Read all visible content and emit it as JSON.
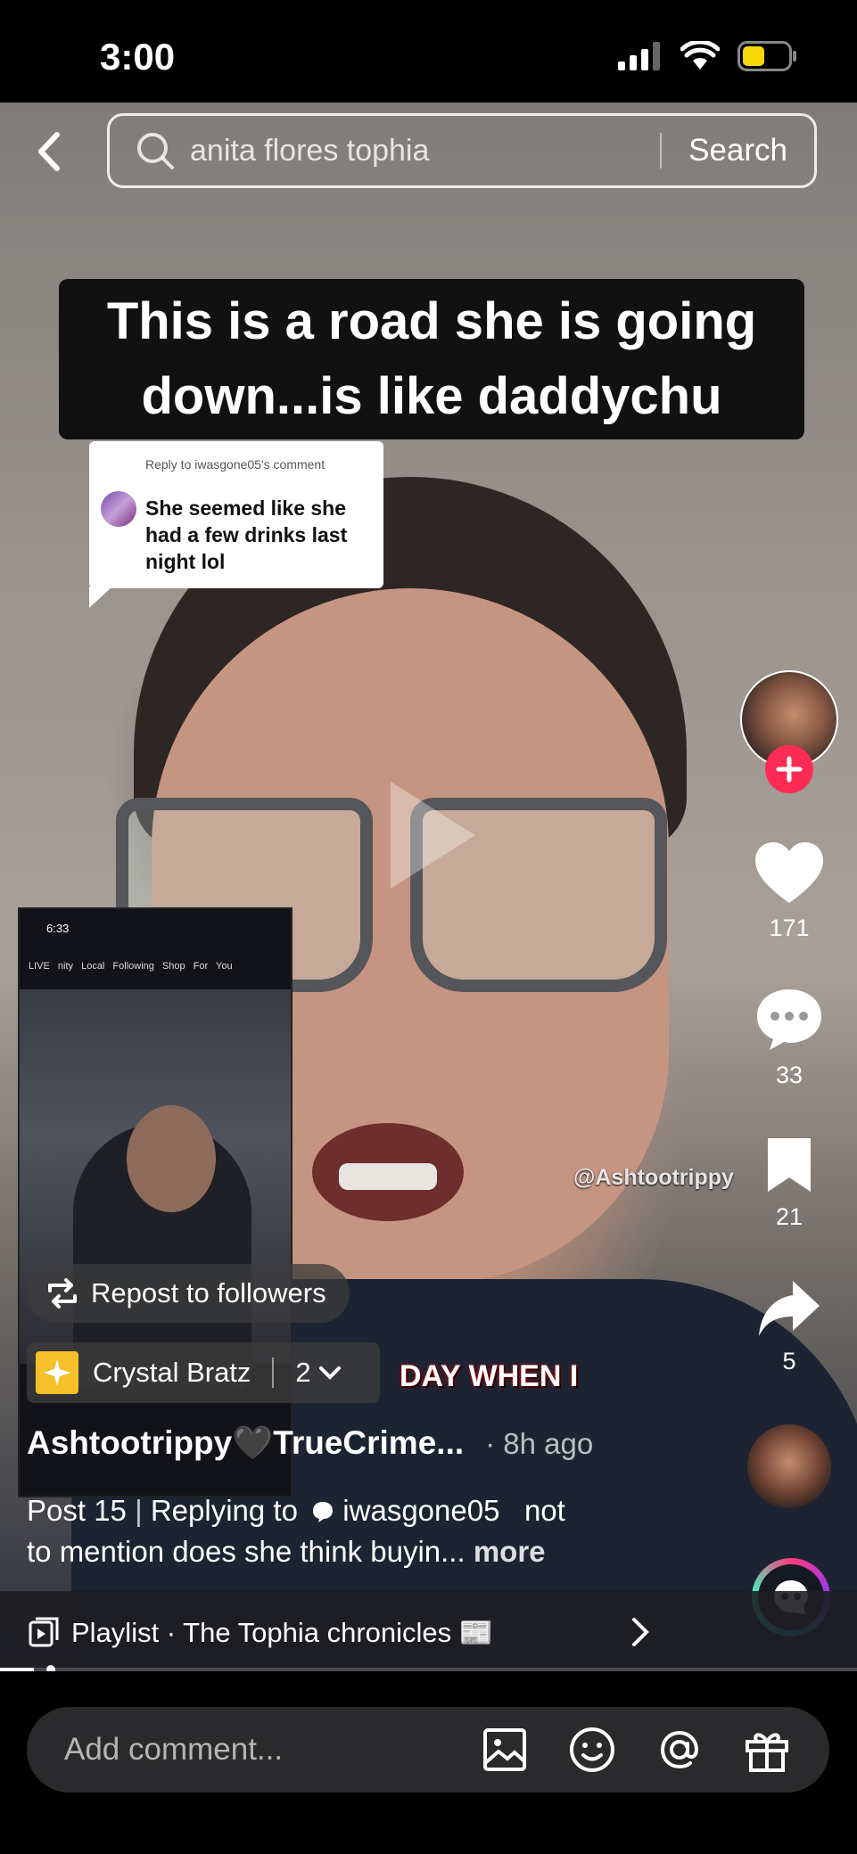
{
  "status_bar": {
    "time": "3:00"
  },
  "search": {
    "query": "anita flores tophia",
    "button_label": "Search"
  },
  "caption": {
    "line1": "This is a road she is going",
    "line2": "down...is like daddychu"
  },
  "reply": {
    "header": "Reply to iwasgone05's comment",
    "text": "She seemed like she had a few drinks last night lol"
  },
  "pip": {
    "status_time": "6:33",
    "tabs": "LIVE nity Local Following Shop For You"
  },
  "overlay": {
    "watermark": "@Ashtootrippy",
    "subtitle": "DAY WHEN I"
  },
  "actions": {
    "likes": "171",
    "comments": "33",
    "saves": "21",
    "shares": "5"
  },
  "repost": {
    "label": "Repost to followers"
  },
  "collab": {
    "name": "Crystal Bratz",
    "count": "2"
  },
  "post": {
    "author": "Ashtootrippy🖤TrueCrime...",
    "time": "· 8h ago",
    "series": "Post 15",
    "reply_prefix": "Replying to",
    "reply_user": "iwasgone05",
    "text_start": "not",
    "text_cont": "to mention does she think buyin...",
    "more": "more"
  },
  "playlist": {
    "label": "Playlist · The Tophia chronicles 📰"
  },
  "comment": {
    "placeholder": "Add comment..."
  },
  "colors": {
    "follow": "#fe2c55",
    "battery": "#f5d80b"
  },
  "icons": [
    "back-icon",
    "search-icon",
    "play-icon",
    "heart-icon",
    "comment-icon",
    "bookmark-icon",
    "share-icon",
    "repost-icon",
    "playlist-icon",
    "chevron-right-icon",
    "image-icon",
    "emoji-icon",
    "mention-icon",
    "gift-icon",
    "ai-chat-icon"
  ]
}
